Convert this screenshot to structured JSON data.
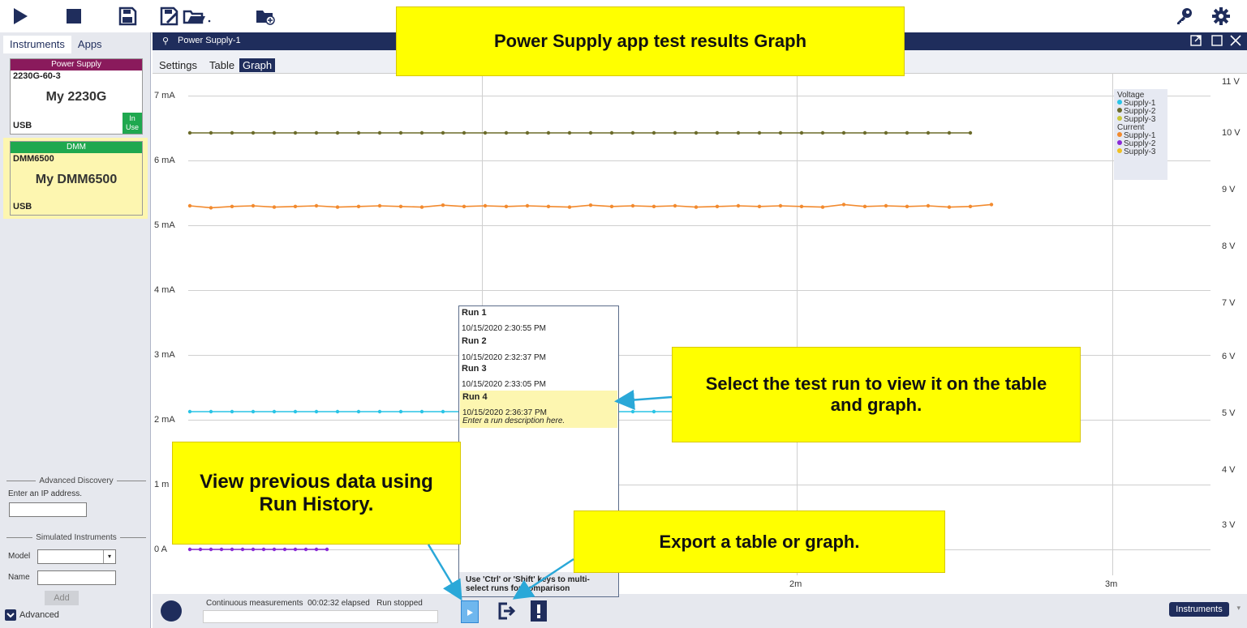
{
  "toolbar": {
    "icons": [
      "play-icon",
      "stop-icon",
      "save-icon",
      "save-as-icon",
      "open-icon",
      "new-folder-icon",
      "key-icon",
      "gear-icon"
    ],
    "accent": "#1f2d5c"
  },
  "left": {
    "tab_instruments": "Instruments",
    "tab_apps": "Apps",
    "card1": {
      "header": "Power Supply",
      "header_color": "#8a1a5c",
      "model": "2230G-60-3",
      "name": "My 2230G",
      "conn": "USB",
      "in_use": "In Use"
    },
    "card2": {
      "header": "DMM",
      "header_color": "#1fa84f",
      "model": "DMM6500",
      "name": "My DMM6500",
      "conn": "USB"
    },
    "adv_discovery": "Advanced Discovery",
    "ip_label": "Enter an IP address.",
    "sim_instruments": "Simulated Instruments",
    "model_label": "Model",
    "name_label": "Name",
    "add_button": "Add",
    "advanced": "Advanced"
  },
  "main": {
    "title": "Power Supply-1",
    "subtabs": [
      "Settings",
      "Table",
      "Graph"
    ],
    "active_subtab": "Graph"
  },
  "chart_data": {
    "type": "line",
    "x_ticks": [
      "2m",
      "3m"
    ],
    "y_left_ticks": [
      "7 mA",
      "6 mA",
      "5 mA",
      "4 mA",
      "3 mA",
      "2 mA",
      "1 m",
      "0 A"
    ],
    "y_right_ticks": [
      "11 V",
      "10 V",
      "9 V",
      "8 V",
      "7 V",
      "6 V",
      "5 V",
      "4 V",
      "3 V"
    ],
    "legend": {
      "voltage_title": "Voltage",
      "current_title": "Current",
      "voltage_series": [
        {
          "name": "Supply-1",
          "color": "#29c4e6"
        },
        {
          "name": "Supply-2",
          "color": "#6b6b2a"
        },
        {
          "name": "Supply-3",
          "color": "#c9c83a"
        }
      ],
      "current_series": [
        {
          "name": "Supply-1",
          "color": "#f28a2e"
        },
        {
          "name": "Supply-2",
          "color": "#8a2ad6"
        },
        {
          "name": "Supply-3",
          "color": "#f0c020"
        }
      ]
    },
    "series": [
      {
        "name": "Voltage Supply-2",
        "axis": "right",
        "color": "#6b6b2a",
        "values": [
          10,
          10,
          10,
          10,
          10,
          10,
          10,
          10,
          10,
          10,
          10,
          10,
          10,
          10,
          10,
          10,
          10,
          10,
          10,
          10,
          10,
          10,
          10,
          10,
          10,
          10,
          10,
          10,
          10,
          10,
          10,
          10,
          10,
          10,
          10,
          10,
          10,
          10
        ]
      },
      {
        "name": "Current Supply-1",
        "axis": "left",
        "color": "#f28a2e",
        "values": [
          5.3,
          5.27,
          5.29,
          5.3,
          5.28,
          5.29,
          5.3,
          5.28,
          5.29,
          5.3,
          5.29,
          5.28,
          5.31,
          5.29,
          5.3,
          5.29,
          5.3,
          5.29,
          5.28,
          5.31,
          5.29,
          5.3,
          5.29,
          5.3,
          5.28,
          5.29,
          5.3,
          5.29,
          5.3,
          5.29,
          5.28,
          5.32,
          5.29,
          5.3,
          5.29,
          5.3,
          5.28,
          5.29,
          5.32
        ]
      },
      {
        "name": "Voltage Supply-1",
        "axis": "right",
        "color": "#29c4e6",
        "values": [
          5,
          5,
          5,
          5,
          5,
          5,
          5,
          5,
          5,
          5,
          5,
          5,
          5,
          5,
          5,
          5,
          5,
          5,
          5,
          5,
          5,
          5,
          5,
          5,
          5,
          5,
          5,
          5,
          5,
          5,
          5,
          5,
          5,
          5,
          5,
          5,
          5,
          5
        ]
      },
      {
        "name": "Current Supply-2",
        "axis": "left",
        "color": "#8a2ad6",
        "values": [
          0,
          0,
          0,
          0,
          0,
          0,
          0,
          0,
          0,
          0,
          0,
          0,
          0,
          0
        ]
      }
    ]
  },
  "run_history": {
    "runs": [
      {
        "title": "Run 1",
        "date": "10/15/2020 2:30:55 PM"
      },
      {
        "title": "Run 2",
        "date": "10/15/2020 2:32:37 PM"
      },
      {
        "title": "Run 3",
        "date": "10/15/2020 2:33:05 PM"
      },
      {
        "title": "Run 4",
        "date": "10/15/2020 2:36:37 PM",
        "description": "Enter a run description here.",
        "selected": true
      }
    ],
    "hint": "Use 'Ctrl' or 'Shift' keys to multi-select runs for comparison"
  },
  "status": {
    "measurement": "Continuous measurements",
    "elapsed": "00:02:32 elapsed",
    "state": "Run stopped",
    "instruments_button": "Instruments"
  },
  "callouts": {
    "title": "Power Supply app test results Graph",
    "select_run": "Select the test run to view it on the table and graph.",
    "history": "View previous data using Run History.",
    "export": "Export a table or graph."
  }
}
